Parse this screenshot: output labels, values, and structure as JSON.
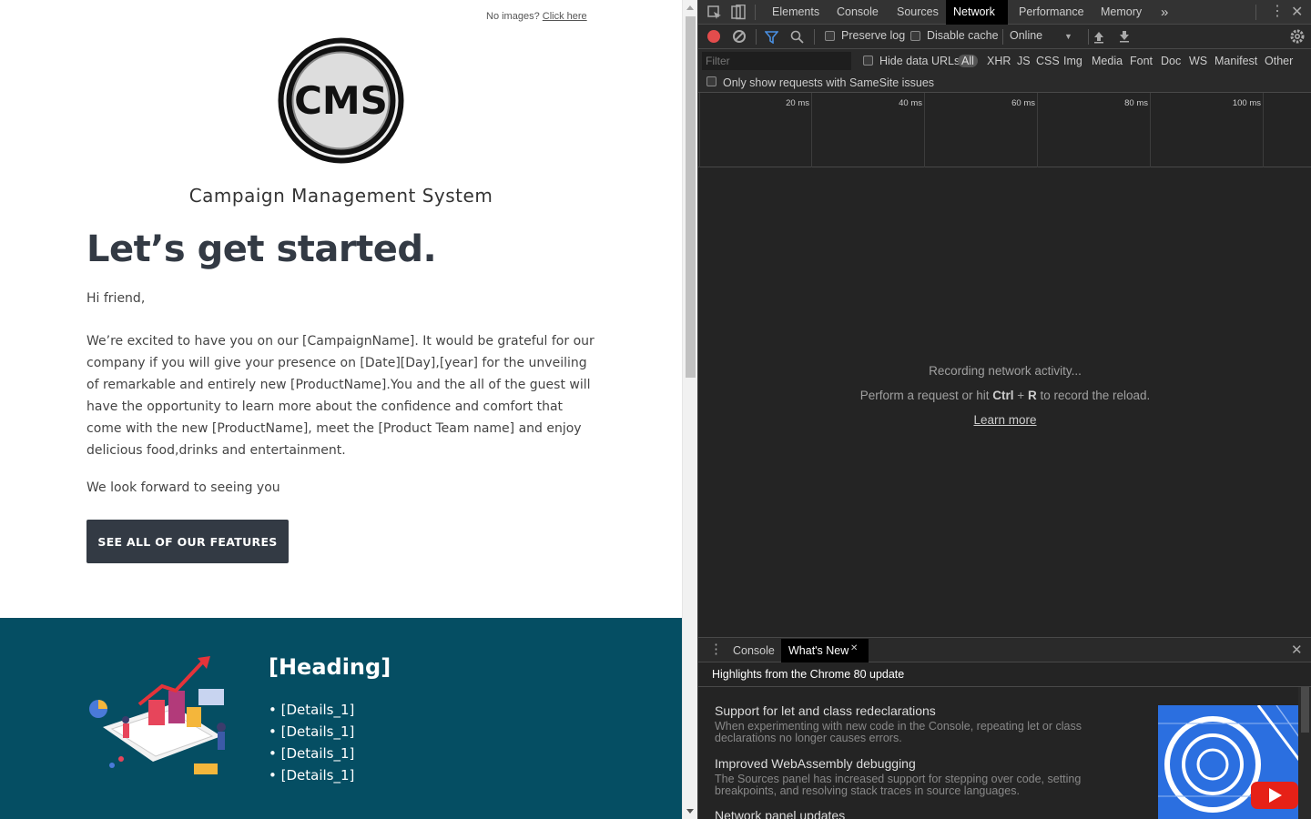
{
  "email": {
    "no_images_text": "No images?",
    "click_here": "Click here",
    "logo_text": "CMS",
    "brand": "Campaign Management System",
    "headline": "Let’s get started.",
    "greeting": "Hi friend,",
    "body": "We’re excited to have you on our [CampaignName]. It would be grateful for our company if you will give your presence on [Date][Day],[year] for the unveiling of remarkable and entirely new [ProductName].You and the all of the guest will have the opportunity to learn more about the confidence and comfort that come with the new [ProductName], meet the [Product Team name] and enjoy delicious food,drinks and entertainment.",
    "closing": "We look forward to seeing you",
    "cta_label": "SEE ALL OF OUR FEATURES",
    "band": {
      "heading": "[Heading]",
      "details": [
        "• [Details_1]",
        "• [Details_1]",
        "• [Details_1]",
        "• [Details_1]"
      ],
      "bg_color": "#054e63"
    }
  },
  "devtools": {
    "tabs": [
      "Elements",
      "Console",
      "Sources",
      "Network",
      "Performance",
      "Memory"
    ],
    "active_tab": "Network",
    "more_tabs_icon": "»",
    "toolbar": {
      "preserve_log": "Preserve log",
      "disable_cache": "Disable cache",
      "throttle": "Online"
    },
    "filter": {
      "placeholder": "Filter",
      "hide_data_urls": "Hide data URLs",
      "types": [
        "All",
        "XHR",
        "JS",
        "CSS",
        "Img",
        "Media",
        "Font",
        "Doc",
        "WS",
        "Manifest",
        "Other"
      ],
      "samesite": "Only show requests with SameSite issues"
    },
    "timeline_labels": [
      "20 ms",
      "40 ms",
      "60 ms",
      "80 ms",
      "100 ms"
    ],
    "empty_state": {
      "line1": "Recording network activity...",
      "line2_pre": "Perform a request or hit ",
      "line2_key1": "Ctrl",
      "line2_plus": " + ",
      "line2_key2": "R",
      "line2_post": " to record the reload.",
      "learn_more": "Learn more"
    },
    "drawer": {
      "tabs": [
        "Console",
        "What's New"
      ],
      "active_tab": "What's New",
      "title": "Highlights from the Chrome 80 update",
      "items": [
        {
          "heading": "Support for let and class redeclarations",
          "desc": "When experimenting with new code in the Console, repeating let or class declarations no longer causes errors."
        },
        {
          "heading": "Improved WebAssembly debugging",
          "desc": "The Sources panel has increased support for stepping over code, setting breakpoints, and resolving stack traces in source languages."
        },
        {
          "heading": "Network panel updates",
          "desc": ""
        }
      ]
    },
    "colors": {
      "record": "#e34c4c",
      "bg": "#242424",
      "active_tab_bg": "#000000"
    }
  }
}
